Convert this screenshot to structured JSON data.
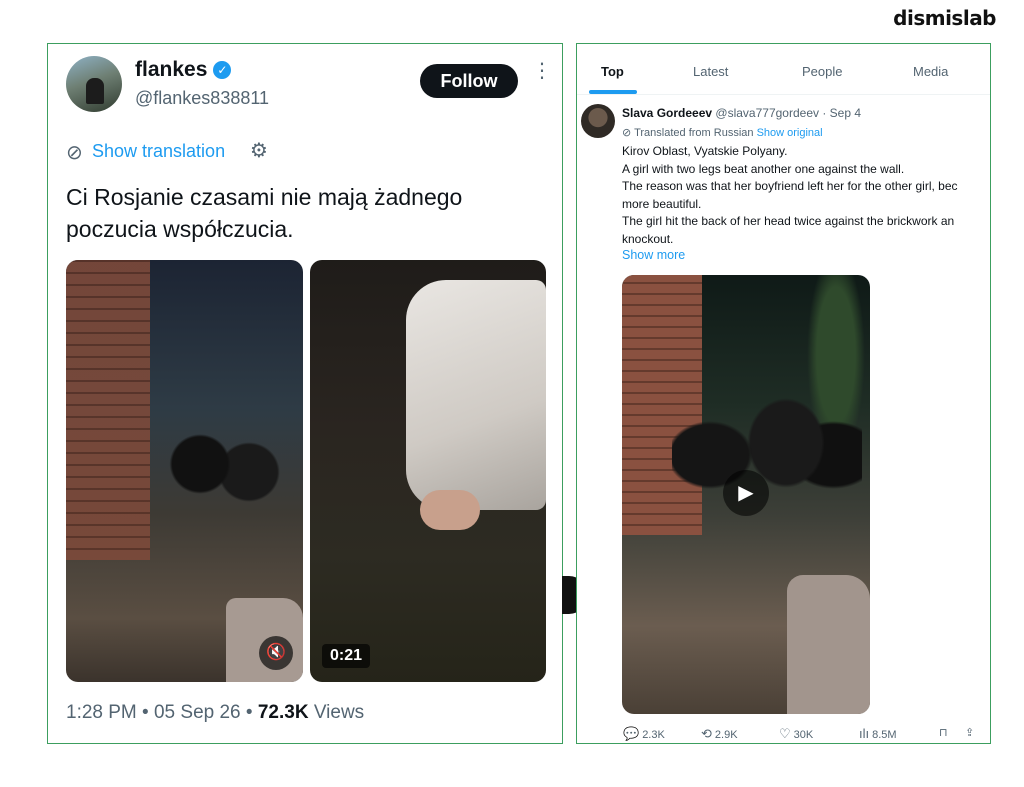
{
  "brand": "dismislab",
  "left_post": {
    "display_name": "flankes",
    "handle": "@flankes838811",
    "follow_label": "Follow",
    "more_icon": "⋮",
    "show_translation": "Show translation",
    "text": "Ci Rosjanie czasami nie mają żadnego poczucia współczucia.",
    "video_duration": "0:21",
    "time": "1:28 PM",
    "date": "05 Sep 26",
    "views_count": "72.3K",
    "views_label": "Views",
    "sep": "•"
  },
  "right_post": {
    "tabs": [
      "Top",
      "Latest",
      "People",
      "Media"
    ],
    "author_name": "Slava Gordeeev",
    "author_handle": "@slava777gordeev",
    "date": "· Sep 4",
    "translated_from": "Translated from Russian",
    "show_original": "Show original",
    "lines": [
      "Kirov Oblast, Vyatskie Polyany.",
      "A girl with two legs beat another one against the wall.",
      "The reason was that her boyfriend left her for the other girl, bec",
      "more beautiful.",
      "The girl hit the back of her head twice against the brickwork an",
      "knockout."
    ],
    "show_more": "Show more",
    "replies": "2.3K",
    "reposts": "2.9K",
    "likes": "30K",
    "views": "8.5M"
  },
  "colors": {
    "accent": "#1d9bf0",
    "frame": "#3c9e5f",
    "text": "#0f1419",
    "muted": "#536471"
  }
}
